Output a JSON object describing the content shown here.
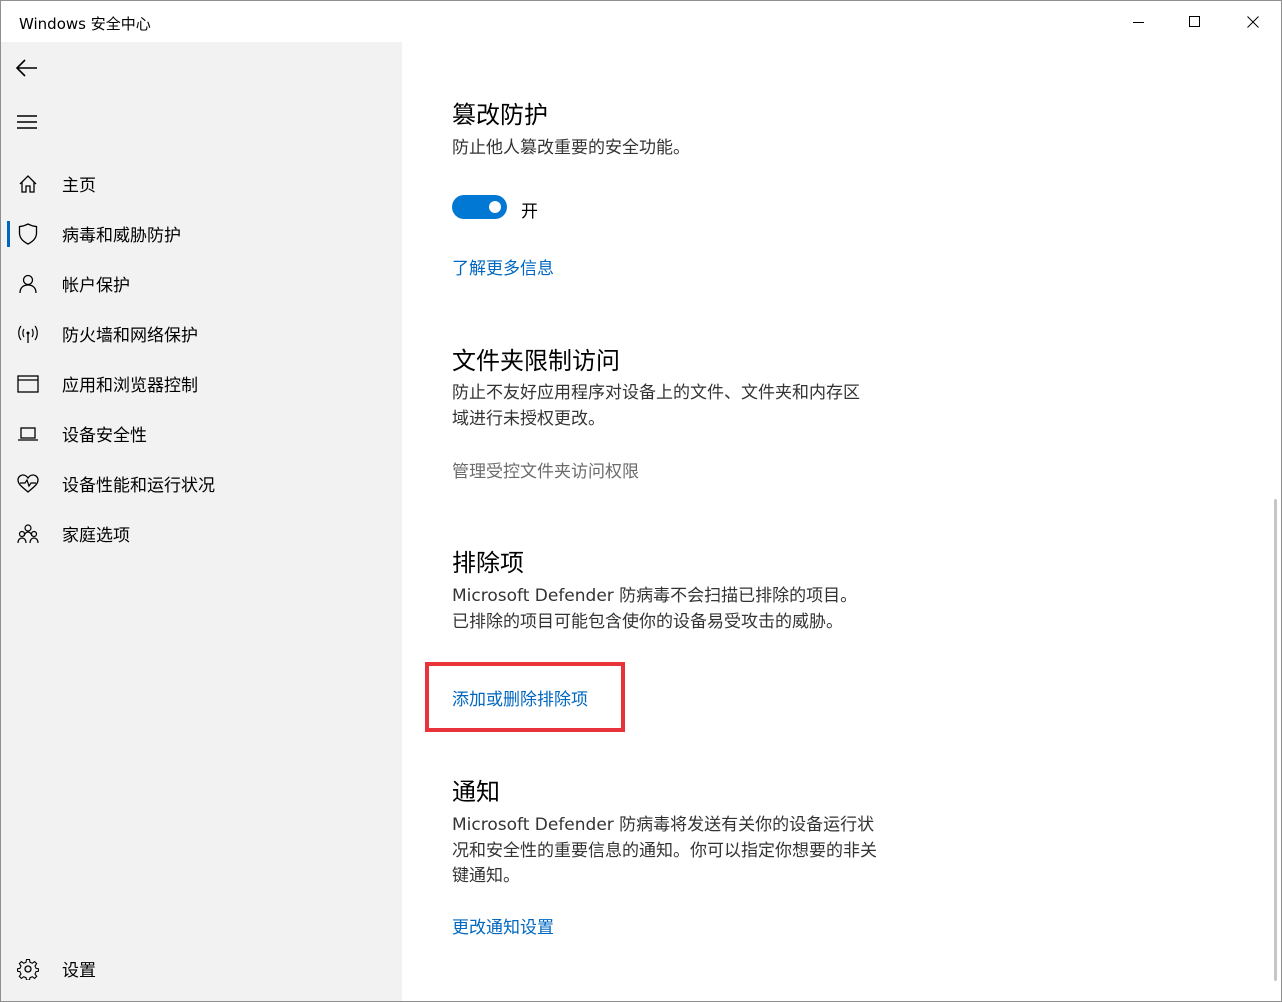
{
  "window": {
    "title": "Windows 安全中心",
    "controls": {
      "minimize": "minimize-icon",
      "maximize": "maximize-icon",
      "close": "close-icon"
    }
  },
  "sidebar": {
    "back_icon": "back-arrow-icon",
    "menu_icon": "hamburger-menu-icon",
    "active_accent": "#0067c0",
    "items": [
      {
        "label": "主页",
        "icon": "home-icon"
      },
      {
        "label": "病毒和威胁防护",
        "icon": "shield-icon",
        "active": true
      },
      {
        "label": "帐户保护",
        "icon": "person-icon"
      },
      {
        "label": "防火墙和网络保护",
        "icon": "wifi-antenna-icon"
      },
      {
        "label": "应用和浏览器控制",
        "icon": "browser-window-icon"
      },
      {
        "label": "设备安全性",
        "icon": "laptop-icon"
      },
      {
        "label": "设备性能和运行状况",
        "icon": "heart-pulse-icon"
      },
      {
        "label": "家庭选项",
        "icon": "family-icon"
      }
    ],
    "settings": {
      "label": "设置",
      "icon": "gear-icon"
    }
  },
  "main": {
    "tamper": {
      "title": "篡改防护",
      "desc": "防止他人篡改重要的安全功能。",
      "toggle_label": "开",
      "toggle_on": true,
      "link": "了解更多信息"
    },
    "folder": {
      "title": "文件夹限制访问",
      "desc": "防止不友好应用程序对设备上的文件、文件夹和内存区域进行未授权更改。",
      "link": "管理受控文件夹访问权限"
    },
    "exclusions": {
      "title": "排除项",
      "desc": "Microsoft Defender 防病毒不会扫描已排除的项目。已排除的项目可能包含使你的设备易受攻击的威胁。",
      "link": "添加或删除排除项"
    },
    "notifications": {
      "title": "通知",
      "desc": "Microsoft Defender 防病毒将发送有关你的设备运行状况和安全性的重要信息的通知。你可以指定你想要的非关键通知。",
      "link": "更改通知设置"
    }
  },
  "colors": {
    "link": "#0067c0",
    "toggle_on": "#0078d4",
    "highlight": "#e8333a",
    "sidebar_bg": "#f2f2f2"
  }
}
